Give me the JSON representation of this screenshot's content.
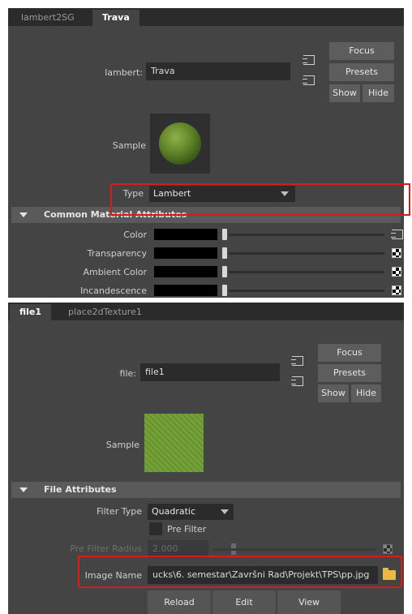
{
  "panel1": {
    "tabs": [
      {
        "label": "lambert2SG",
        "active": false
      },
      {
        "label": "Trava",
        "active": true
      }
    ],
    "material": {
      "label": "lambert:",
      "value": "Trava"
    },
    "buttons": {
      "focus": "Focus",
      "presets": "Presets",
      "show": "Show",
      "hide": "Hide"
    },
    "sample_label": "Sample",
    "type": {
      "label": "Type",
      "value": "Lambert"
    },
    "section_title": "Common Material Attributes",
    "attributes": [
      {
        "label": "Color",
        "map_icon": "output-connection-icon"
      },
      {
        "label": "Transparency",
        "map_icon": "checker-map-icon"
      },
      {
        "label": "Ambient Color",
        "map_icon": "checker-map-icon"
      },
      {
        "label": "Incandescence",
        "map_icon": "checker-map-icon"
      }
    ]
  },
  "panel2": {
    "tabs": [
      {
        "label": "file1",
        "active": true
      },
      {
        "label": "place2dTexture1",
        "active": false
      }
    ],
    "file": {
      "label": "file:",
      "value": "file1"
    },
    "buttons": {
      "focus": "Focus",
      "presets": "Presets",
      "show": "Show",
      "hide": "Hide"
    },
    "sample_label": "Sample",
    "section_title": "File Attributes",
    "filter_type": {
      "label": "Filter Type",
      "value": "Quadratic"
    },
    "pre_filter": {
      "label": "Pre Filter",
      "checked": false
    },
    "pre_filter_radius": {
      "label": "Pre Filter Radius",
      "value": "2.000"
    },
    "image_name": {
      "label": "Image Name",
      "value": "ucks\\6. semestar\\Završni Rad\\Projekt\\TPS\\pp.jpg"
    },
    "actions": {
      "reload": "Reload",
      "edit": "Edit",
      "view": "View"
    }
  },
  "colors": {
    "panel_bg": "#444444",
    "highlight": "#d81b1b",
    "folder": "#e8b84a"
  }
}
